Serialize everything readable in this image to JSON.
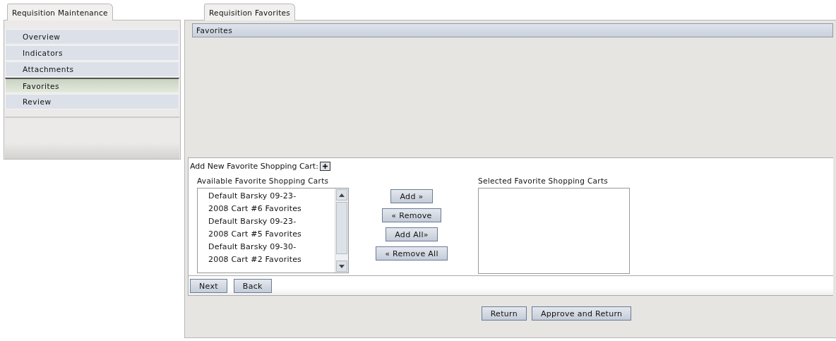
{
  "left_tab": {
    "label": "Requisition Maintenance"
  },
  "nav": [
    {
      "label": "Overview",
      "selected": false
    },
    {
      "label": "Indicators",
      "selected": false
    },
    {
      "label": "Attachments",
      "selected": false
    },
    {
      "label": "Favorites",
      "selected": true
    },
    {
      "label": "Review",
      "selected": false
    }
  ],
  "main_tab": {
    "label": "Requisition Favorites"
  },
  "section_title": "Favorites",
  "add_new_label": "Add New Favorite Shopping Cart:",
  "available": {
    "label": "Available Favorite Shopping Carts",
    "items": [
      "Default Barsky 09-23-2008 Cart #6 Favorites",
      "Default Barsky 09-23-2008 Cart #5 Favorites",
      "Default Barsky 09-30-2008 Cart #2 Favorites"
    ]
  },
  "transfer_buttons": [
    {
      "label": "Add »"
    },
    {
      "label": "« Remove"
    },
    {
      "label": "Add All»"
    },
    {
      "label": "« Remove All"
    }
  ],
  "selected": {
    "label": "Selected Favorite Shopping Carts"
  },
  "wizard_buttons": [
    {
      "label": "Next"
    },
    {
      "label": "Back"
    }
  ],
  "footer_buttons": [
    {
      "label": "Return"
    },
    {
      "label": "Approve and Return"
    }
  ]
}
